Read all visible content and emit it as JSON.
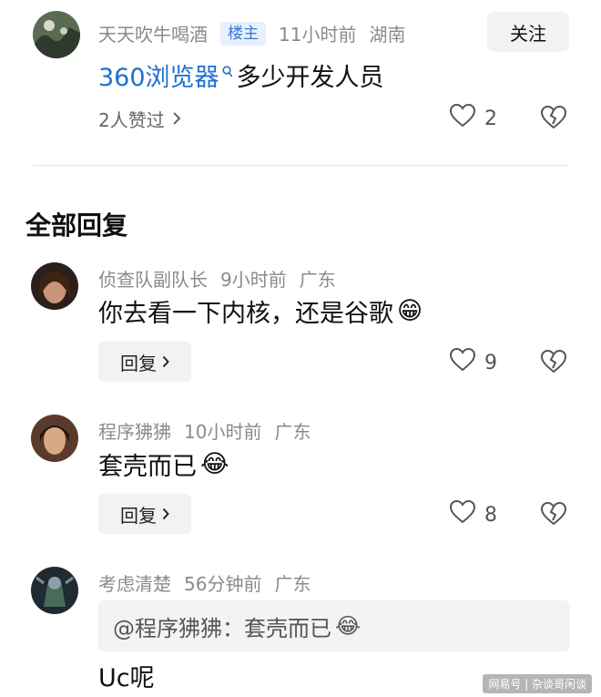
{
  "post": {
    "author": "天天吹牛喝酒",
    "badge": "楼主",
    "time": "11小时前",
    "location": "湖南",
    "follow_label": "关注",
    "content_link": "360浏览器",
    "content_rest": " 多少开发人员",
    "liked_by": "2人赞过",
    "like_count": "2"
  },
  "section_title": "全部回复",
  "replies": [
    {
      "author": "侦查队副队长",
      "time": "9小时前",
      "location": "广东",
      "text": "你去看一下内核，还是谷歌",
      "emoji": "😁",
      "reply_label": "回复",
      "like_count": "9"
    },
    {
      "author": "程序狒狒",
      "time": "10小时前",
      "location": "广东",
      "text": "套壳而已",
      "emoji": "😂",
      "reply_label": "回复",
      "like_count": "8"
    },
    {
      "author": "考虑清楚",
      "time": "56分钟前",
      "location": "广东",
      "quote_text": "@程序狒狒：套壳而已",
      "quote_emoji": "😂",
      "text": "Uc呢"
    }
  ],
  "watermark": "网易号 | 杂谈哥闲谈",
  "colors": {
    "link": "#1f6fd1",
    "badge_bg": "#e7f0fc",
    "button_bg": "#f2f2f2"
  }
}
